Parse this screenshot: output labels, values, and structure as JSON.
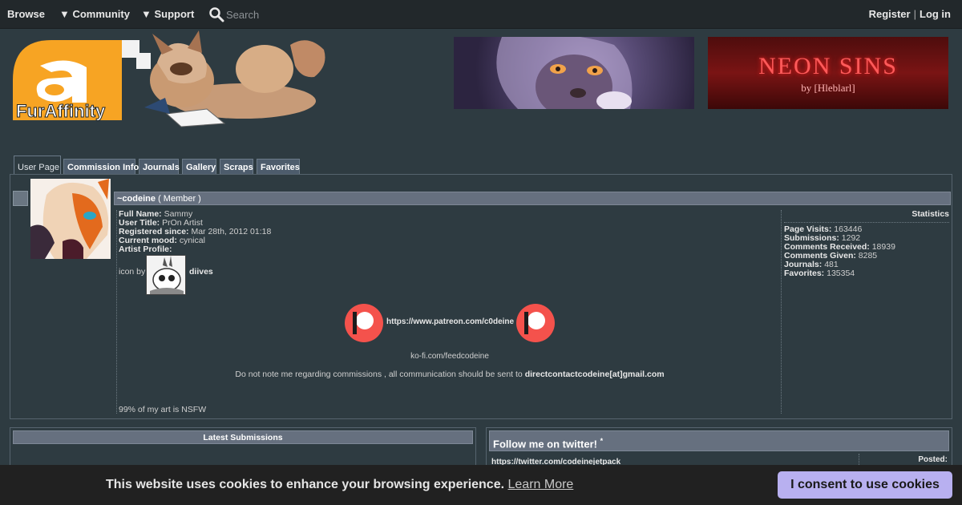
{
  "nav": {
    "browse": "Browse",
    "community": "▼ Community",
    "support": "▼ Support",
    "search_placeholder": "Search",
    "register": "Register",
    "separator": "|",
    "login": "Log in"
  },
  "logo": {
    "text": "FurAffinity"
  },
  "banners": {
    "right_title": "NEON SINS",
    "right_sub": "by [Hleblarl]"
  },
  "tabs": [
    "User Page",
    "Commission Info",
    "Journals",
    "Gallery",
    "Scraps",
    "Favorites"
  ],
  "profile": {
    "username": "~codeine",
    "member_tag": "( Member )",
    "full_name_label": "Full Name:",
    "full_name": "Sammy",
    "user_title_label": "User Title:",
    "user_title": "PrOn Artist",
    "registered_label": "Registered since:",
    "registered": "Mar 28th, 2012 01:18",
    "mood_label": "Current mood:",
    "mood": "cynical",
    "artist_profile_label": "Artist Profile:",
    "icon_by": "icon by",
    "icon_author": "diives",
    "patreon_url": "https://www.patreon.com/c0deine",
    "kofi": "ko-fi.com/feedcodeine",
    "note_text": "Do not note me regarding commissions , all communication should be sent to",
    "note_email": "directcontactcodeine[at]gmail.com",
    "nsfw": "99% of my art is NSFW"
  },
  "statistics": {
    "title": "Statistics",
    "items": [
      {
        "label": "Page Visits:",
        "value": "163446"
      },
      {
        "label": "Submissions:",
        "value": "1292"
      },
      {
        "label": "Comments Received:",
        "value": "18939"
      },
      {
        "label": "Comments Given:",
        "value": "8285"
      },
      {
        "label": "Journals:",
        "value": "481"
      },
      {
        "label": "Favorites:",
        "value": "135354"
      }
    ]
  },
  "latest_submissions": {
    "title": "Latest Submissions"
  },
  "twitter": {
    "title": "Follow me on twitter!",
    "star": "*",
    "link": "https://twitter.com/codeinejetpack",
    "posted": "Posted:"
  },
  "cookie": {
    "text": "This website uses cookies to enhance your browsing experience.",
    "learn_more": "Learn More",
    "consent": "I consent to use cookies"
  },
  "colors": {
    "page_bg": "#2e3b41",
    "header_bar": "#66707f",
    "logo_orange": "#f7a423",
    "cookie_button": "#b8b0f0",
    "patreon": "#f4524c"
  }
}
